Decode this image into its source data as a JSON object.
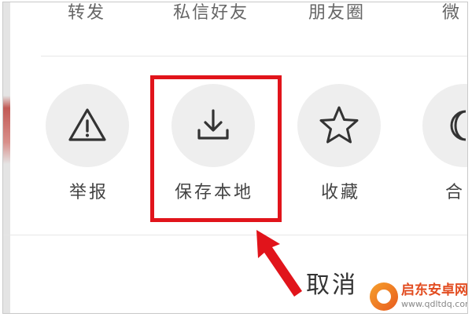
{
  "share_row": {
    "items": [
      {
        "label": "转发"
      },
      {
        "label": "私信好友"
      },
      {
        "label": "朋友圈"
      },
      {
        "label": "微"
      }
    ]
  },
  "actions": {
    "items": [
      {
        "label": "举报",
        "icon": "warning-triangle-icon"
      },
      {
        "label": "保存本地",
        "icon": "download-icon"
      },
      {
        "label": "收藏",
        "icon": "star-icon"
      },
      {
        "label": "合",
        "icon": "moon-icon"
      }
    ]
  },
  "cancel_label": "取消",
  "highlight_color": "#e1141b",
  "watermark": {
    "title": "启东安卓网",
    "url": "www.qdltdq.com"
  }
}
